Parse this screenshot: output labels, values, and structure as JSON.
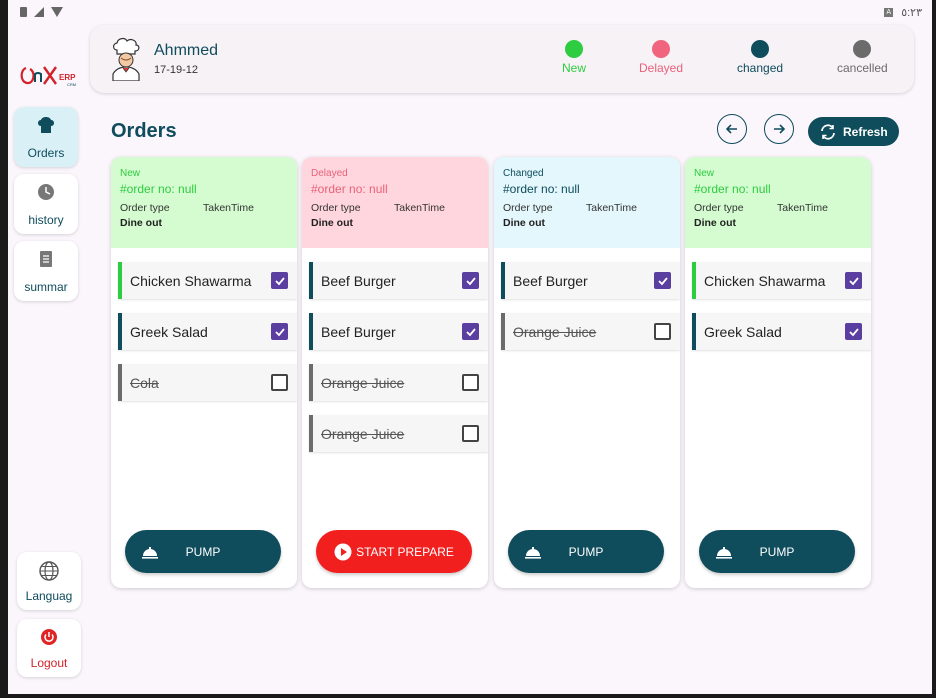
{
  "statusbar": {
    "time": "٥:٢٣"
  },
  "header": {
    "user_name": "Ahmmed",
    "user_date": "17-19-12"
  },
  "legend": [
    {
      "label": "New",
      "color": "#2ecc40",
      "text_color": "#2ecc40"
    },
    {
      "label": "Delayed",
      "color": "#f0647e",
      "text_color": "#e8627a"
    },
    {
      "label": "changed",
      "color": "#0f4c5c",
      "text_color": "#0f4c5c"
    },
    {
      "label": "cancelled",
      "color": "#6b6b6b",
      "text_color": "#6b6b6b"
    }
  ],
  "sidebar": {
    "items": [
      {
        "label": "Orders",
        "icon": "chef-hat-icon"
      },
      {
        "label": "history",
        "icon": "clock-icon"
      },
      {
        "label": "summar",
        "icon": "document-icon"
      }
    ],
    "language_label": "Languag",
    "logout_label": "Logout"
  },
  "page_title": "Orders",
  "refresh_label": "Refresh",
  "orders": [
    {
      "status": "New",
      "order_no": "#order no: null",
      "order_type_label": "Order type",
      "taken_time_label": "TakenTime",
      "order_type": "Dine out",
      "items": [
        {
          "name": "Chicken Shawarma",
          "checked": true,
          "cancelled": false
        },
        {
          "name": "Greek Salad",
          "checked": true,
          "cancelled": false
        },
        {
          "name": "Cola",
          "checked": false,
          "cancelled": true
        }
      ],
      "button": "PUMP"
    },
    {
      "status": "Delayed",
      "order_no": "#order no: null",
      "order_type_label": "Order type",
      "taken_time_label": "TakenTime",
      "order_type": "Dine out",
      "items": [
        {
          "name": "Beef Burger",
          "checked": true,
          "cancelled": false
        },
        {
          "name": "Beef Burger",
          "checked": true,
          "cancelled": false
        },
        {
          "name": "Orange Juice",
          "checked": false,
          "cancelled": true
        },
        {
          "name": "Orange Juice",
          "checked": false,
          "cancelled": true
        }
      ],
      "button": "START PREPARE"
    },
    {
      "status": "Changed",
      "order_no": "#order no: null",
      "order_type_label": "Order type",
      "taken_time_label": "TakenTime",
      "order_type": "Dine out",
      "items": [
        {
          "name": "Beef Burger",
          "checked": true,
          "cancelled": false
        },
        {
          "name": "Orange Juice",
          "checked": false,
          "cancelled": true
        }
      ],
      "button": "PUMP"
    },
    {
      "status": "New",
      "order_no": "#order no: null",
      "order_type_label": "Order type",
      "taken_time_label": "TakenTime",
      "order_type": "Dine out",
      "items": [
        {
          "name": "Chicken Shawarma",
          "checked": true,
          "cancelled": false
        },
        {
          "name": "Greek Salad",
          "checked": true,
          "cancelled": false
        }
      ],
      "button": "PUMP"
    }
  ],
  "colors": {
    "primary": "#0f4c5c",
    "new_bg": "#d4fcd0",
    "delayed_bg": "#ffd6dd",
    "changed_bg": "#e3f7fc",
    "start_btn": "#f21f1f",
    "checkbox": "#5a3ea0"
  }
}
